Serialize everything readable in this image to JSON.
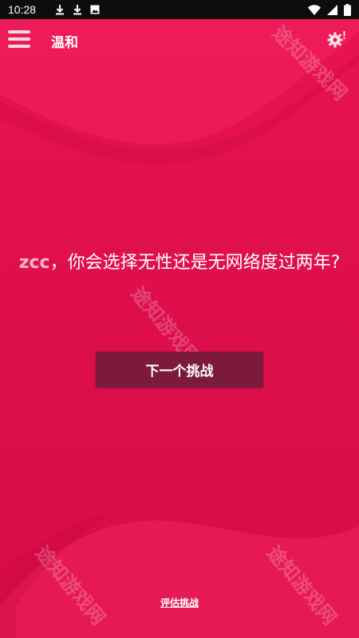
{
  "status_bar": {
    "time": "10:28"
  },
  "app_bar": {
    "title": "温和"
  },
  "question": {
    "name": "zcc",
    "text": "，你会选择无性还是无网络度过两年?"
  },
  "next_button": {
    "label": "下一个挑战"
  },
  "rate_link": {
    "label": "评估挑战"
  },
  "watermark": {
    "text": "途知游戏网"
  },
  "colors": {
    "background": "#e3104e",
    "button": "#7c1a3d",
    "name_highlight": "#ffb6c9"
  }
}
